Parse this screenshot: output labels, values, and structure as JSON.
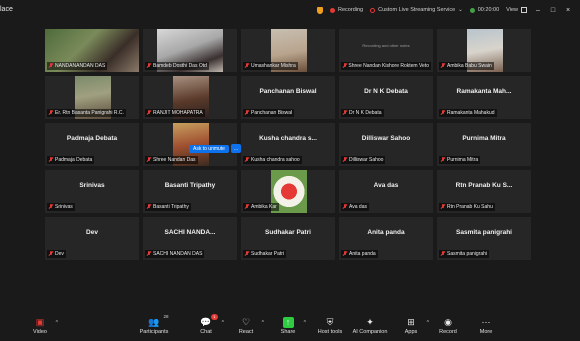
{
  "window": {
    "title": "lace",
    "recording_label": "Recording",
    "streaming_label": "Custom Live Streaming Service",
    "timer": "00:20:00",
    "view_label": "View"
  },
  "gallery": {
    "tiles": [
      {
        "name": "NANDANANDAN DAS",
        "video": "nandan",
        "active": true
      },
      {
        "name": "Bamdeb Dosthi Das Otd",
        "video": "bs"
      },
      {
        "name": "Umashankar Mishra",
        "video": "um"
      },
      {
        "name": "Shree Nandan Kishore Roktem Veto",
        "center_name": "",
        "note": "Recording and other notes"
      },
      {
        "name": "Ambika Babu Swain",
        "video": "am"
      },
      {
        "name": "Er. Rtn Basanta Panigrahi R.C.",
        "video": "er"
      },
      {
        "name": "RANJIT MOHAPATRA",
        "video": "rm"
      },
      {
        "name": "Panchanan Biswal",
        "center_name": "Panchanan Biswal"
      },
      {
        "name": "Dr N K Debata",
        "center_name": "Dr N K Debata"
      },
      {
        "name": "Ramakanta Mahakud",
        "center_name": "Ramakanta  Mah..."
      },
      {
        "name": "Padmaja Debata",
        "center_name": "Padmaja Debata"
      },
      {
        "name": "Shree Nandan Das",
        "video": "snd"
      },
      {
        "name": "Kusha chandra sahoo",
        "center_name": "Kusha chandra s..."
      },
      {
        "name": "Dilliswar Sahoo",
        "center_name": "Dilliswar Sahoo"
      },
      {
        "name": "Purnima Mitra",
        "center_name": "Purnima Mitra"
      },
      {
        "name": "Srinivas",
        "center_name": "Srinivas"
      },
      {
        "name": "Basanti Tripathy",
        "center_name": "Basanti Tripathy"
      },
      {
        "name": "Ambika Kar",
        "video": "ak"
      },
      {
        "name": "Ava das",
        "center_name": "Ava das"
      },
      {
        "name": "Rtn Pranab Ku Sahu",
        "center_name": "Rtn Pranab Ku S..."
      },
      {
        "name": "Dev",
        "center_name": "Dev"
      },
      {
        "name": "SACHI NANDAN DAS",
        "center_name": "SACHI  NANDA..."
      },
      {
        "name": "Sudhakar Patri",
        "center_name": "Sudhakar Patri"
      },
      {
        "name": "Anita panda",
        "center_name": "Anita panda"
      },
      {
        "name": "Sasmita panigrahi",
        "center_name": "Sasmita panigrahi"
      }
    ],
    "ask_button": {
      "label": "Ask to unmute",
      "more": "..."
    }
  },
  "toolbar": {
    "video_label": "Video",
    "participants_label": "Participants",
    "participants_count": "28",
    "chat_label": "Chat",
    "chat_badge": "1",
    "react_label": "React",
    "share_label": "Share",
    "host_tools_label": "Host tools",
    "ai_label": "AI Companion",
    "apps_label": "Apps",
    "record_label": "Record",
    "more_label": "More"
  },
  "colors": {
    "background": "#1a1a1a",
    "tile": "#262626",
    "active_border": "#2ecc40",
    "muted_red": "#e53935",
    "accent_blue": "#0e72ed"
  }
}
